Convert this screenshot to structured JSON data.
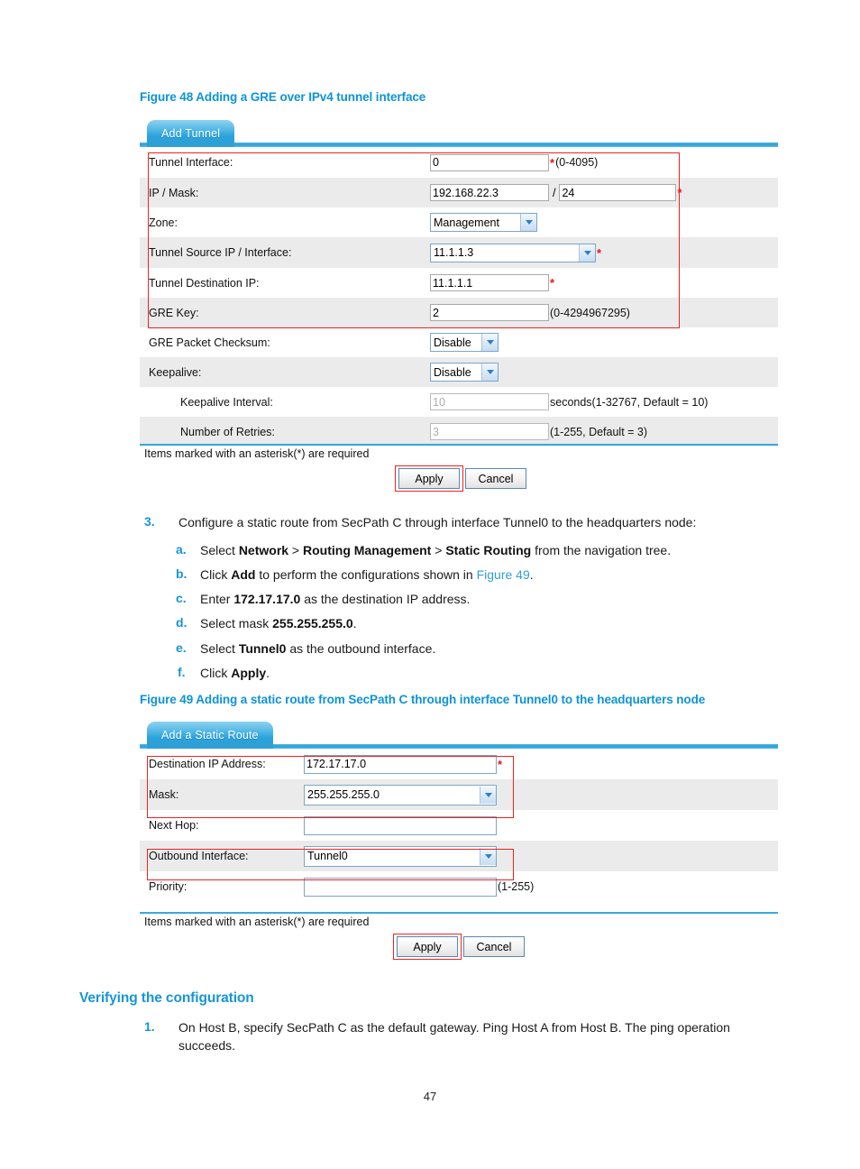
{
  "figure48": {
    "caption": "Figure 48 Adding a GRE over IPv4 tunnel interface",
    "tab_label": "Add Tunnel",
    "rows": [
      {
        "label": "Tunnel Interface:",
        "value": "0",
        "hint": "(0-4095)",
        "required": true
      },
      {
        "label": "IP / Mask:",
        "value": "192.168.22.3",
        "value2": "24",
        "separator": "/",
        "required": true
      },
      {
        "label": "Zone:",
        "value": "Management"
      },
      {
        "label": "Tunnel Source IP / Interface:",
        "value": "11.1.1.3",
        "required": true
      },
      {
        "label": "Tunnel Destination IP:",
        "value": "11.1.1.1",
        "required": true
      },
      {
        "label": "GRE Key:",
        "value": "2",
        "hint": "(0-4294967295)"
      },
      {
        "label": "GRE Packet Checksum:",
        "value": "Disable"
      },
      {
        "label": "Keepalive:",
        "value": "Disable"
      },
      {
        "label": "Keepalive Interval:",
        "value": "10",
        "hint": "seconds(1-32767, Default = 10)"
      },
      {
        "label": "Number of Retries:",
        "value": "3",
        "hint": "(1-255, Default = 3)"
      }
    ],
    "required_note": "Items marked with an asterisk(*) are required",
    "apply_label": "Apply",
    "cancel_label": "Cancel"
  },
  "step3": {
    "number": "3.",
    "text": "Configure a static route from SecPath C through interface Tunnel0 to the headquarters node:",
    "substeps": [
      {
        "marker": "a.",
        "parts": [
          {
            "t": "Select "
          },
          {
            "t": "Network",
            "bold": true
          },
          {
            "t": " > "
          },
          {
            "t": "Routing Management",
            "bold": true
          },
          {
            "t": " > "
          },
          {
            "t": "Static Routing",
            "bold": true
          },
          {
            "t": " from the navigation tree."
          }
        ]
      },
      {
        "marker": "b.",
        "parts": [
          {
            "t": "Click "
          },
          {
            "t": "Add",
            "bold": true
          },
          {
            "t": " to perform the configurations shown in "
          },
          {
            "t": "Figure 49",
            "link": true
          },
          {
            "t": "."
          }
        ]
      },
      {
        "marker": "c.",
        "parts": [
          {
            "t": "Enter "
          },
          {
            "t": "172.17.17.0",
            "bold": true
          },
          {
            "t": " as the destination IP address."
          }
        ]
      },
      {
        "marker": "d.",
        "parts": [
          {
            "t": "Select mask "
          },
          {
            "t": "255.255.255.0",
            "bold": true
          },
          {
            "t": "."
          }
        ]
      },
      {
        "marker": "e.",
        "parts": [
          {
            "t": "Select "
          },
          {
            "t": "Tunnel0",
            "bold": true
          },
          {
            "t": " as the outbound interface."
          }
        ]
      },
      {
        "marker": "f.",
        "parts": [
          {
            "t": "Click "
          },
          {
            "t": "Apply",
            "bold": true
          },
          {
            "t": "."
          }
        ]
      }
    ]
  },
  "figure49": {
    "caption": "Figure 49 Adding a static route from SecPath C through interface Tunnel0 to the headquarters node",
    "tab_label": "Add a Static Route",
    "rows": [
      {
        "label": "Destination IP Address:",
        "value": "172.17.17.0",
        "required": true
      },
      {
        "label": "Mask:",
        "value": "255.255.255.0"
      },
      {
        "label": "Next Hop:",
        "value": ""
      },
      {
        "label": "Outbound Interface:",
        "value": "Tunnel0"
      },
      {
        "label": "Priority:",
        "value": "",
        "hint": "(1-255)"
      }
    ],
    "required_note": "Items marked with an asterisk(*) are required",
    "apply_label": "Apply",
    "cancel_label": "Cancel"
  },
  "verify": {
    "heading": "Verifying the configuration",
    "number": "1.",
    "text": "On Host B, specify SecPath C as the default gateway. Ping Host A from Host B. The ping operation succeeds."
  },
  "footer": {
    "page_number": "47"
  },
  "colors": {
    "accent": "#1695d6",
    "caption": "#0d93d6",
    "highlight": "#ee2222"
  }
}
